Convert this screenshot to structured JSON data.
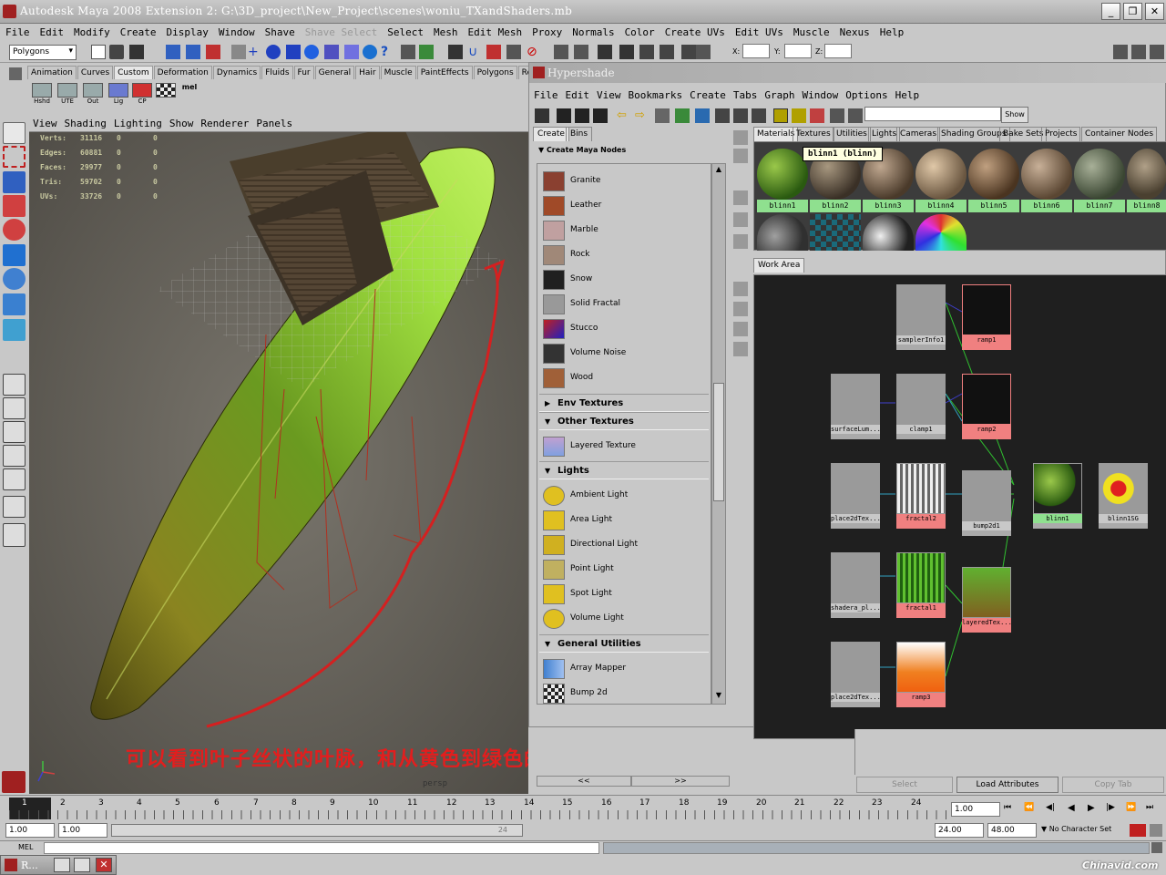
{
  "window": {
    "title": "Autodesk Maya 2008 Extension 2: G:\\3D_project\\New_Project\\scenes\\woniu_TXandShaders.mb"
  },
  "menubar": [
    "File",
    "Edit",
    "Modify",
    "Create",
    "Display",
    "Window",
    "Shave",
    "Shave Select",
    "Select",
    "Mesh",
    "Edit Mesh",
    "Proxy",
    "Normals",
    "Color",
    "Create UVs",
    "Edit UVs",
    "Muscle",
    "Nexus",
    "Help"
  ],
  "status": {
    "mode": "Polygons",
    "x_label": "X:",
    "y_label": "Y:",
    "z_label": "Z:"
  },
  "shelf_tabs": [
    "Animation",
    "Curves",
    "Custom",
    "Deformation",
    "Dynamics",
    "Fluids",
    "Fur",
    "General",
    "Hair",
    "Muscle",
    "PaintEffects",
    "Polygons",
    "Rendering"
  ],
  "shelf_active": "Custom",
  "shelf_buttons": [
    "Hshd",
    "UTE",
    "Out",
    "Lig",
    "CP"
  ],
  "viewport": {
    "menu": [
      "View",
      "Shading",
      "Lighting",
      "Show",
      "Renderer",
      "Panels"
    ],
    "stats": [
      {
        "label": "Verts:",
        "a": "31116",
        "b": "0",
        "c": "0"
      },
      {
        "label": "Edges:",
        "a": "60881",
        "b": "0",
        "c": "0"
      },
      {
        "label": "Faces:",
        "a": "29977",
        "b": "0",
        "c": "0"
      },
      {
        "label": "Tris:",
        "a": "59702",
        "b": "0",
        "c": "0"
      },
      {
        "label": "UVs:",
        "a": "33726",
        "b": "0",
        "c": "0"
      }
    ],
    "caption": "可以看到叶子丝状的叶脉，和从黄色到绿色的颜色变化.",
    "camera": "persp"
  },
  "hypershade": {
    "title": "Hypershade",
    "menu": [
      "File",
      "Edit",
      "View",
      "Bookmarks",
      "Create",
      "Tabs",
      "Graph",
      "Window",
      "Options",
      "Help"
    ],
    "show_button": "Show",
    "left_tabs": [
      "Create",
      "Bins"
    ],
    "create_header": "Create Maya Nodes",
    "textures": [
      "Granite",
      "Leather",
      "Marble",
      "Rock",
      "Snow",
      "Solid Fractal",
      "Stucco",
      "Volume Noise",
      "Wood"
    ],
    "sections": [
      "Env Textures",
      "Other Textures",
      "Lights",
      "General Utilities"
    ],
    "other_textures": [
      "Layered Texture"
    ],
    "lights": [
      "Ambient Light",
      "Area Light",
      "Directional Light",
      "Point Light",
      "Spot Light",
      "Volume Light"
    ],
    "utilities": [
      "Array Mapper",
      "Bump 2d"
    ],
    "nav": {
      "prev": "<<",
      "next": ">>"
    },
    "right_tabs": [
      "Materials",
      "Textures",
      "Utilities",
      "Lights",
      "Cameras",
      "Shading Groups",
      "Bake Sets",
      "Projects",
      "Container Nodes"
    ],
    "materials": [
      "blinn1",
      "blinn2",
      "blinn3",
      "blinn4",
      "blinn5",
      "blinn6",
      "blinn7",
      "blinn8"
    ],
    "tooltip": "blinn1 (blinn)",
    "work_area_tab": "Work Area",
    "nodes": {
      "sampler": "samplerInfo1",
      "ramp1": "ramp1",
      "surface": "surfaceLum...",
      "clamp": "clamp1",
      "ramp2": "ramp2",
      "place1": "place2dTex...",
      "fractal2": "fractal2",
      "bump": "bump2d1",
      "blinn": "blinn1",
      "sg": "blinn1SG",
      "place2": "shadera_pl...",
      "fractal1": "fractal1",
      "layered": "layeredTex...",
      "place3": "place2dTex...",
      "ramp3": "ramp3"
    },
    "bottom_buttons": [
      "Select",
      "Load Attributes",
      "Copy Tab"
    ]
  },
  "timeline": {
    "ticks": [
      "1",
      "2",
      "3",
      "4",
      "5",
      "6",
      "7",
      "8",
      "9",
      "10",
      "11",
      "12",
      "13",
      "14",
      "15",
      "16",
      "17",
      "18",
      "19",
      "20",
      "21",
      "22",
      "23",
      "24"
    ],
    "current": "1.00"
  },
  "range": {
    "start": "1.00",
    "start2": "1.00",
    "mid": "24",
    "end": "24.00",
    "end2": "48.00",
    "char_set": "No Character Set"
  },
  "cmd": {
    "label": "MEL"
  },
  "taskbar": {
    "item": "R..."
  },
  "watermark": "Chinavid.com"
}
